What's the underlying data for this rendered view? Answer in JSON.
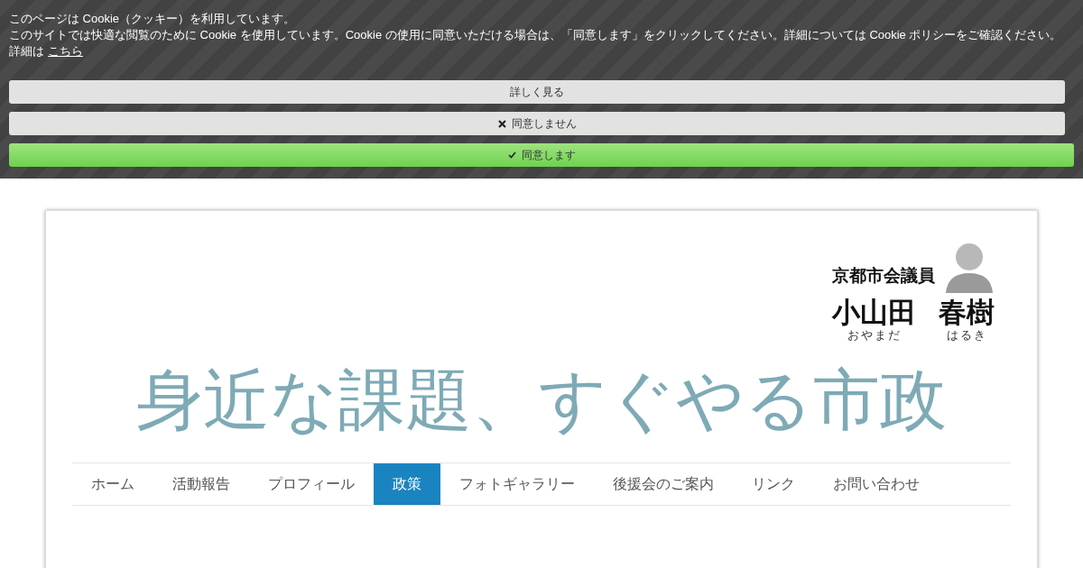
{
  "cookie_banner": {
    "title": "このページは Cookie（クッキー）を利用しています。",
    "message": "このサイトでは快適な閲覧のために Cookie を使用しています。Cookie の使用に同意いただける場合は、「同意します」をクリックしてください。詳細については Cookie ポリシーをご確認ください。",
    "details_prefix": "詳細は",
    "details_link": "こちら",
    "buttons": [
      {
        "kind": "more",
        "label": "詳しく見る"
      },
      {
        "kind": "decline",
        "label": "同意しません"
      },
      {
        "kind": "accept",
        "label": "同意します"
      }
    ]
  },
  "header": {
    "logo": {
      "role": "京都市会議員",
      "surname": "小山田",
      "given_name": "春樹",
      "surname_reading": "おやまだ",
      "given_name_reading": "はるき"
    },
    "tagline": "身近な課題、すぐやる市政"
  },
  "nav": [
    {
      "label": "ホーム",
      "selected": false
    },
    {
      "label": "活動報告",
      "selected": false
    },
    {
      "label": "プロフィール",
      "selected": false
    },
    {
      "label": "政策",
      "selected": true
    },
    {
      "label": "フォトギャラリー",
      "selected": false
    },
    {
      "label": "後援会のご案内",
      "selected": false
    },
    {
      "label": "リンク",
      "selected": false
    },
    {
      "label": "お問い合わせ",
      "selected": false
    }
  ]
}
